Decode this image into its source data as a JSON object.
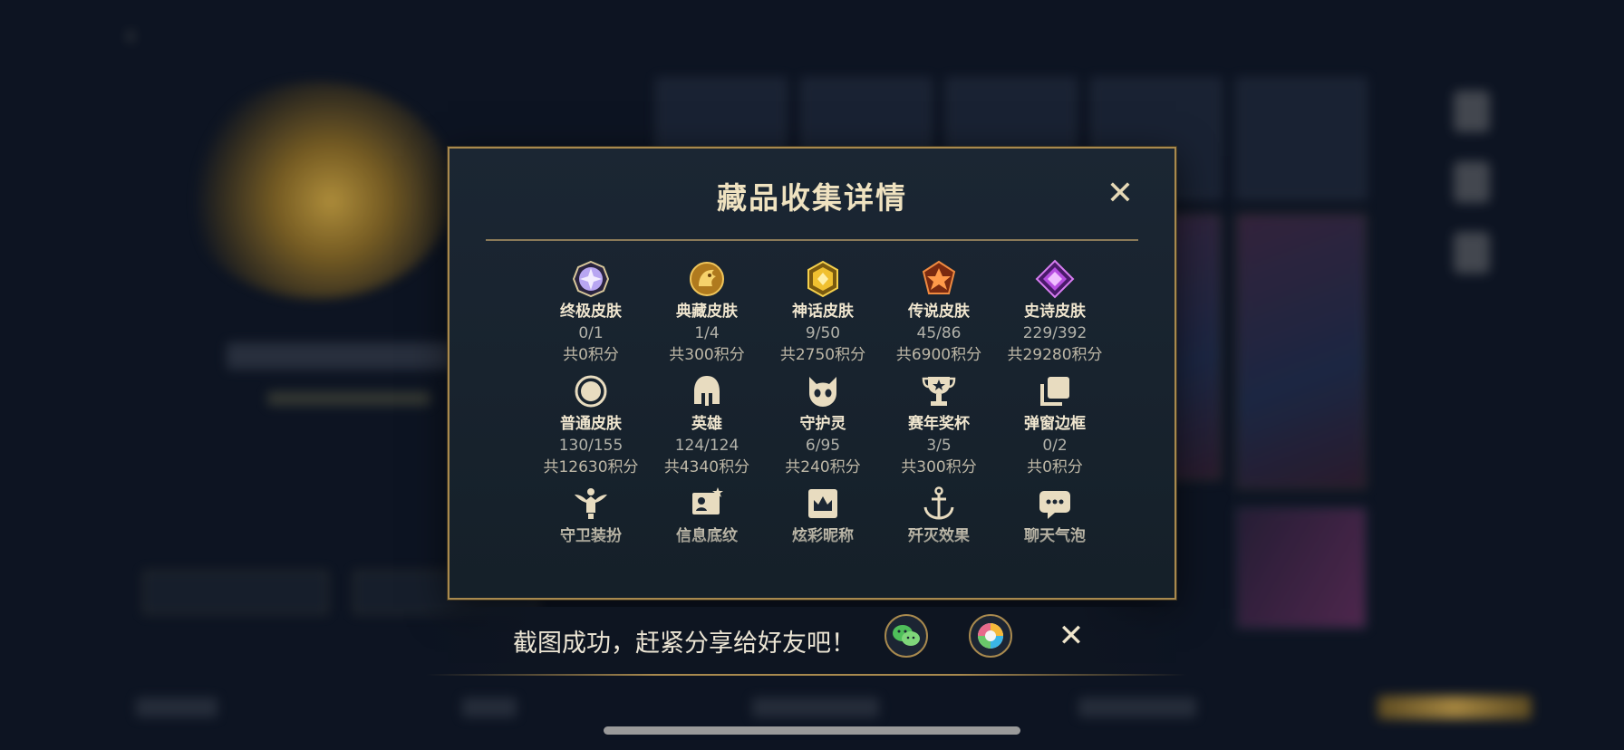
{
  "modal": {
    "title": "藏品收集详情",
    "close_symbol": "✕",
    "rows": [
      [
        {
          "icon": "ultimate-skin-icon",
          "name": "终极皮肤",
          "count": "0/1",
          "points": "共0积分"
        },
        {
          "icon": "collection-skin-icon",
          "name": "典藏皮肤",
          "count": "1/4",
          "points": "共300积分"
        },
        {
          "icon": "mythic-skin-icon",
          "name": "神话皮肤",
          "count": "9/50",
          "points": "共2750积分"
        },
        {
          "icon": "legendary-skin-icon",
          "name": "传说皮肤",
          "count": "45/86",
          "points": "共6900积分"
        },
        {
          "icon": "epic-skin-icon",
          "name": "史诗皮肤",
          "count": "229/392",
          "points": "共29280积分"
        }
      ],
      [
        {
          "icon": "normal-skin-icon",
          "name": "普通皮肤",
          "count": "130/155",
          "points": "共12630积分"
        },
        {
          "icon": "hero-helmet-icon",
          "name": "英雄",
          "count": "124/124",
          "points": "共4340积分"
        },
        {
          "icon": "guardian-spirit-icon",
          "name": "守护灵",
          "count": "6/95",
          "points": "共240积分"
        },
        {
          "icon": "season-trophy-icon",
          "name": "赛年奖杯",
          "count": "3/5",
          "points": "共300积分"
        },
        {
          "icon": "popup-frame-icon",
          "name": "弹窗边框",
          "count": "0/2",
          "points": "共0积分"
        }
      ],
      [
        {
          "icon": "guard-outfit-icon",
          "name": "守卫装扮"
        },
        {
          "icon": "info-pattern-icon",
          "name": "信息底纹"
        },
        {
          "icon": "colorful-nickname-icon",
          "name": "炫彩昵称"
        },
        {
          "icon": "kill-effect-icon",
          "name": "歼灭效果"
        },
        {
          "icon": "chat-bubble-icon",
          "name": "聊天气泡"
        }
      ]
    ]
  },
  "share_bar": {
    "message": "截图成功，赶紧分享给好友吧！",
    "close_symbol": "✕"
  },
  "colors": {
    "gold_border": "#a8894e",
    "modal_bg": "#1b2633",
    "title_text": "#efe2c0"
  }
}
